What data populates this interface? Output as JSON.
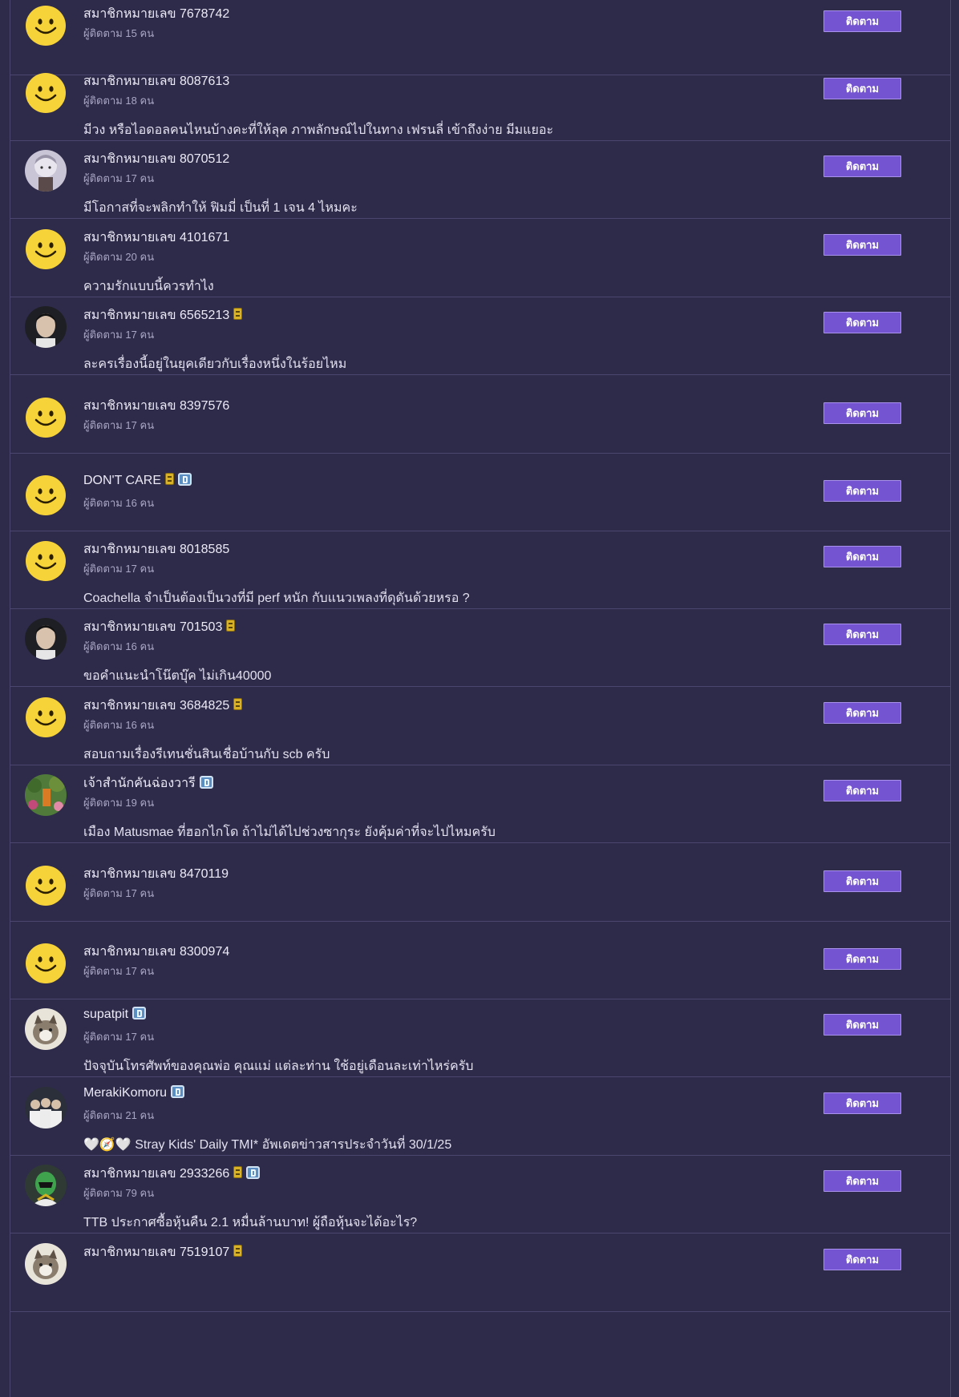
{
  "follow_label": "ติดตาม",
  "colors": {
    "background": "#2e2b4a",
    "divider": "#4a4670",
    "button": "#7454d0",
    "smiley": "#f7d33a"
  },
  "members": [
    {
      "name": "สมาชิกหมายเลข 7678742",
      "followers": "ผู้ติดตาม 15 คน",
      "topic": "",
      "avatar": "smiley-icon",
      "badges": []
    },
    {
      "name": "สมาชิกหมายเลข 8087613",
      "followers": "ผู้ติดตาม 18 คน",
      "topic": "มีวง หรือไอดอลคนไหนบ้างคะที่ให้ลุค ภาพลักษณ์ไปในทาง เฟรนลี่ เข้าถึงง่าย มีมแยอะ",
      "avatar": "smiley-icon",
      "badges": []
    },
    {
      "name": "สมาชิกหมายเลข 8070512",
      "followers": "ผู้ติดตาม 17 คน",
      "topic": "มีโอกาสที่จะพลิกทำให้ ฟิมมี่ เป็นที่ 1 เจน 4 ไหมคะ",
      "avatar": "anime-avatar",
      "badges": []
    },
    {
      "name": "สมาชิกหมายเลข 4101671",
      "followers": "ผู้ติดตาม 20 คน",
      "topic": "ความรักแบบนี้ควรทำไง",
      "avatar": "smiley-icon",
      "badges": []
    },
    {
      "name": "สมาชิกหมายเลข 6565213",
      "followers": "ผู้ติดตาม 17 คน",
      "topic": "ละครเรื่องนี้อยู่ในยุคเดียวกับเรื่องหนึ่งในร้อยไหม",
      "avatar": "photo-avatar",
      "badges": [
        "member-badge-icon"
      ]
    },
    {
      "name": "สมาชิกหมายเลข 8397576",
      "followers": "ผู้ติดตาม 17 คน",
      "topic": "",
      "avatar": "smiley-icon",
      "badges": []
    },
    {
      "name": "DON'T CARE",
      "followers": "ผู้ติดตาม 16 คน",
      "topic": "",
      "avatar": "smiley-icon",
      "badges": [
        "member-badge-icon",
        "blogger-badge-icon"
      ]
    },
    {
      "name": "สมาชิกหมายเลข 8018585",
      "followers": "ผู้ติดตาม 17 คน",
      "topic": "Coachella จำเป็นต้องเป็นวงที่มี perf หนัก กับแนวเพลงที่ดุดันด้วยหรอ ?",
      "avatar": "smiley-icon",
      "badges": []
    },
    {
      "name": "สมาชิกหมายเลข 701503",
      "followers": "ผู้ติดตาม 16 คน",
      "topic": "ขอคำแนะนำโน๊ตบุ๊ค ไม่เกิน40000",
      "avatar": "photo-avatar",
      "badges": [
        "member-badge-icon"
      ]
    },
    {
      "name": "สมาชิกหมายเลข 3684825",
      "followers": "ผู้ติดตาม 16 คน",
      "topic": "สอบถามเรื่องรีเทนชั่นสินเชื่อบ้านกับ scb ครับ",
      "avatar": "smiley-icon",
      "badges": [
        "member-badge-icon"
      ]
    },
    {
      "name": "เจ้าสำนักคันฉ่องวารี",
      "followers": "ผู้ติดตาม 19 คน",
      "topic": "เมือง Matusmae ที่ฮอกไกโด ถ้าไม่ได้ไปช่วงซากุระ ยังคุ้มค่าที่จะไปไหมครับ",
      "avatar": "garden-avatar",
      "badges": [
        "blogger-badge-icon"
      ]
    },
    {
      "name": "สมาชิกหมายเลข 8470119",
      "followers": "ผู้ติดตาม 17 คน",
      "topic": "",
      "avatar": "smiley-icon",
      "badges": []
    },
    {
      "name": "สมาชิกหมายเลข 8300974",
      "followers": "ผู้ติดตาม 17 คน",
      "topic": "",
      "avatar": "smiley-icon",
      "badges": []
    },
    {
      "name": "supatpit",
      "followers": "ผู้ติดตาม 17 คน",
      "topic": "ปัจจุบันโทรศัพท์ของคุณพ่อ คุณแม่ แต่ละท่าน ใช้อยู่เดือนละเท่าไหร่ครับ",
      "avatar": "cat-avatar",
      "badges": [
        "blogger-badge-icon"
      ]
    },
    {
      "name": "MerakiKomoru",
      "followers": "ผู้ติดตาม 21 คน",
      "topic": "🤍🧭🤍 Stray Kids' Daily TMI* อัพเดตข่าวสารประจำวันที่ 30/1/25",
      "avatar": "group-avatar",
      "badges": [
        "blogger-badge-icon"
      ]
    },
    {
      "name": "สมาชิกหมายเลข 2933266",
      "followers": "ผู้ติดตาม 79 คน",
      "topic": "TTB ประกาศซื้อหุ้นคืน 2.1 หมื่นล้านบาท! ผู้ถือหุ้นจะได้อะไร?",
      "avatar": "ranger-avatar",
      "badges": [
        "member-badge-icon",
        "blogger-badge-icon"
      ]
    },
    {
      "name": "สมาชิกหมายเลข 7519107",
      "followers": "",
      "topic": "",
      "avatar": "cat-avatar",
      "badges": [
        "member-badge-icon"
      ]
    }
  ]
}
